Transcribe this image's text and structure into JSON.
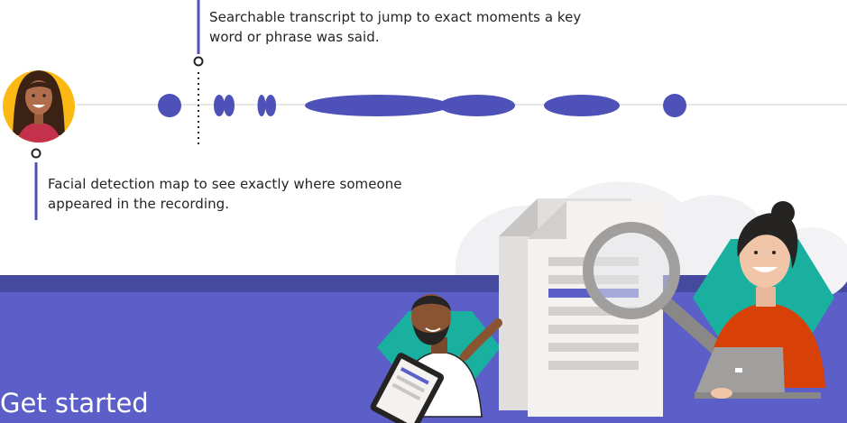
{
  "annotations": {
    "transcript_caption": "Searchable transcript to jump to exact moments a key word or phrase was said.",
    "facial_caption": "Facial detection map to see exactly where someone appeared in the recording."
  },
  "section": {
    "heading": "Get started"
  },
  "colors": {
    "accent": "#5b5fc7",
    "timeline_mark": "#4e52b8",
    "band_edge": "#464a9e",
    "text": "#252423",
    "teal": "#1ab0a0",
    "orange": "#fdb913"
  },
  "icons": {
    "avatar": "woman-avatar",
    "illustration": "document-search-illustration"
  }
}
